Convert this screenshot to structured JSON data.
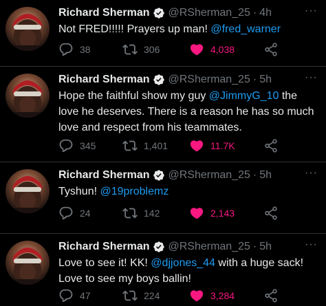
{
  "colors": {
    "background": "#000000",
    "text": "#e7e9ea",
    "muted": "#71767b",
    "mention": "#1d9bf0",
    "like": "#f91880",
    "divider": "#2f3336",
    "verified": "#1d9bf0"
  },
  "icons": {
    "verified": "verified-badge-icon",
    "more": "more-dots-icon",
    "reply": "reply-bubble-icon",
    "retweet": "retweet-arrows-icon",
    "like": "heart-filled-icon",
    "share": "share-icon"
  },
  "tweets": [
    {
      "name": "Richard Sherman",
      "handle": "@RSherman_25",
      "separator": "·",
      "time": "4h",
      "text_before": "Not FRED!!!!! Prayers up man! ",
      "mention": "@fred_warner",
      "text_after": "",
      "replies": "38",
      "retweets": "306",
      "likes": "4,038",
      "liked": true
    },
    {
      "name": "Richard Sherman",
      "handle": "@RSherman_25",
      "separator": "·",
      "time": "5h",
      "text_before": "Hope the faithful show my guy ",
      "mention": "@JimmyG_10",
      "text_after": " the love he deserves.  There is a reason he has so much love and respect from his teammates.",
      "replies": "345",
      "retweets": "1,401",
      "likes": "11.7K",
      "liked": true
    },
    {
      "name": "Richard Sherman",
      "handle": "@RSherman_25",
      "separator": "·",
      "time": "5h",
      "text_before": "Tyshun! ",
      "mention": "@19problemz",
      "text_after": "",
      "replies": "24",
      "retweets": "142",
      "likes": "2,143",
      "liked": true
    },
    {
      "name": "Richard Sherman",
      "handle": "@RSherman_25",
      "separator": "·",
      "time": "5h",
      "text_before": "Love to see it! KK! ",
      "mention": "@djjones_44",
      "text_after": " with a huge sack! Love to see my boys ballin!",
      "replies": "47",
      "retweets": "224",
      "likes": "3,284",
      "liked": true
    }
  ]
}
